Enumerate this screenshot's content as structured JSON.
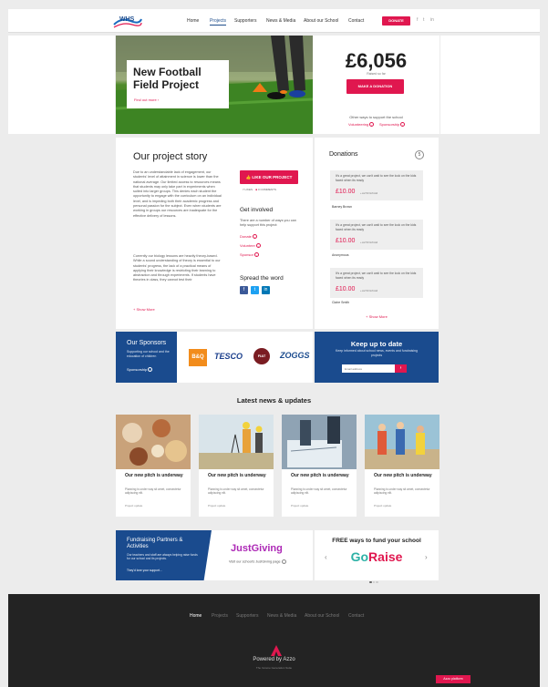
{
  "header": {
    "logo_text": "WHS",
    "nav": [
      "Home",
      "Projects",
      "Supporters",
      "News & Media",
      "About our School",
      "Contact"
    ],
    "donate_label": "DONATE",
    "social": [
      "f",
      "t",
      "in"
    ]
  },
  "hero": {
    "title": "New Football Field Project",
    "find_out_more": "Find out more ›"
  },
  "amount": {
    "value": "£6,056",
    "sub": "Raised so far",
    "donate_label": "MAKE A DONATION",
    "other_ways": "Other ways to support the school",
    "volunteering": "Volunteering",
    "sponsorship": "Sponsorship"
  },
  "story": {
    "title": "Our project story",
    "p1": "Due to an understandable lack of engagement, our students' level of attainment in science is lower than the national average. Our limited access to resources means that students may only take part in experiments when suited into larger groups. This denies each student the opportunity to engage with the curriculum on an individual level, and is impeding both their academic progress and personal passion for the subject. Even when students are working in groups our resources are inadequate for the effective delivery of lessons.",
    "p2": "Currently our biology lessons are heavily theory-based. While a sound understanding of theory is essential to our students' progress, the lack of a practical means of applying their knowledge is restricting their learning to abstraction and through experiments. If students have theories in class, they cannot test their",
    "show_more": "+ Show More",
    "like_label": "LIKE OUR PROJECT",
    "likes": "7 LIKES",
    "comments": "0 COMMENTS",
    "get_involved": "Get involved",
    "gi_text": "There are a number of ways you can help support this project:",
    "links": [
      "Donate",
      "Volunteer",
      "Sponsor"
    ],
    "spread": "Spread the word"
  },
  "donations": {
    "title": "Donations",
    "count": "5",
    "items": [
      {
        "msg": "It's a great project, we can't wait to see the look on the kids faced when its ready",
        "amount": "£10.00",
        "extra": "+ £2.50 Gift Aid",
        "name": "Barney Brown"
      },
      {
        "msg": "It's a great project, we can't wait to see the look on the kids faced when its ready",
        "amount": "£10.00",
        "extra": "+ £2.50 Gift Aid",
        "name": "Anonymous"
      },
      {
        "msg": "It's a great project, we can't wait to see the look on the kids faced when its ready",
        "amount": "£10.00",
        "extra": "+ £2.50 Gift Aid",
        "name": "Claire Smith"
      }
    ],
    "show_more": "+ Show More"
  },
  "sponsors": {
    "title": "Our Sponsors",
    "text": "Supporting our school and the education of children",
    "link": "Sponsorship",
    "logos": [
      "B&Q",
      "TESCO",
      "FIAT",
      "ZOGGS"
    ]
  },
  "keepup": {
    "title": "Keep up to date",
    "text": "Keep informed about school news, events and fundraising projects",
    "placeholder": "Email address",
    "go": "›"
  },
  "news": {
    "title": "Latest news & updates",
    "items": [
      {
        "h": "Our new pitch is underway",
        "p": "Planning is under way sit amet, consectetur adipiscing elit.",
        "s": "Project update"
      },
      {
        "h": "Our new pitch is underway",
        "p": "Planning is under way sit amet, consectetur adipiscing elit.",
        "s": "Project update"
      },
      {
        "h": "Our new pitch is underway",
        "p": "Planning is under way sit amet, consectetur adipiscing elit.",
        "s": "Project update"
      },
      {
        "h": "Our new pitch is underway",
        "p": "Planning is under way sit amet, consectetur adipiscing elit.",
        "s": "Project update"
      }
    ]
  },
  "fund": {
    "title": "Fundraising Partners & Activities",
    "text": "Our teachers and staff are always helping raise funds for our school and its projects.",
    "link": "They'd love your support...",
    "justgiving": "JustGiving",
    "jg_link": "Visit our school's JustGiving page"
  },
  "free": {
    "title": "FREE ways to fund your school",
    "go": "Go",
    "raise": "Raise"
  },
  "footer": {
    "nav": [
      "Home",
      "Projects",
      "Supporters",
      "News & Media",
      "About our School",
      "Contact"
    ],
    "powered": "Powered by Azzo",
    "sub": "The Income Generation Suite",
    "badge": "Azzo platform"
  },
  "colors": {
    "accent": "#e0174f",
    "brand_blue": "#1a4b8e",
    "footer_bg": "#232323"
  }
}
